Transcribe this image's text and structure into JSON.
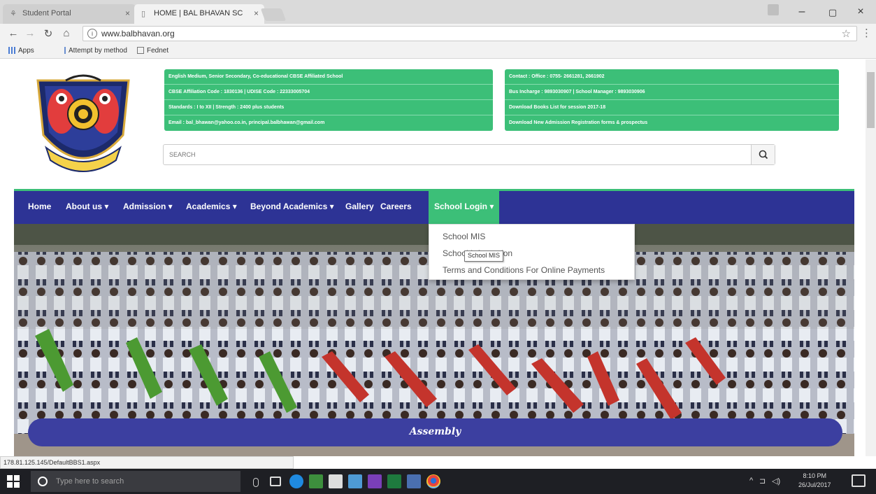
{
  "browser": {
    "tabs": [
      {
        "title": "Student Portal",
        "active": false
      },
      {
        "title": "HOME | BAL BHAVAN SC",
        "active": true
      }
    ],
    "url": "www.balbhavan.org",
    "bookmarks": [
      {
        "label": "Apps"
      },
      {
        "label": "Attempt by method"
      },
      {
        "label": "Fednet"
      }
    ],
    "window_controls": {
      "minimize": "–",
      "maximize": "▢",
      "close": "×"
    },
    "status_url": "178.81.125.145/DefaultBBS1.aspx"
  },
  "header": {
    "info_left": [
      "English Medium, Senior Secondary, Co-educational CBSE Affiliated School",
      "CBSE Affiliation Code : 1830136 | UDISE Code : 22333005704",
      "Standards : I to XII | Strength : 2400 plus students",
      "Email : bal_bhawan@yahoo.co.in, principal.balbhawan@gmail.com"
    ],
    "info_right": [
      "Contact : Office : 0755- 2661281, 2661902",
      "Bus Incharge : 9893030907 | School Manager : 9893030906",
      "Download Books List for session 2017-18",
      "Download New Admission Registration forms & prospectus"
    ],
    "search_placeholder": "SEARCH"
  },
  "nav": {
    "items": [
      {
        "label": "Home"
      },
      {
        "label": "About us ▾"
      },
      {
        "label": "Admission ▾"
      },
      {
        "label": "Academics ▾"
      },
      {
        "label": "Beyond Academics ▾"
      },
      {
        "label": "Gallery"
      },
      {
        "label": "Careers"
      },
      {
        "label": "School Login ▾",
        "active": true
      }
    ],
    "dropdown": [
      "School MIS",
      "School Information",
      "Terms and Conditions For Online Payments"
    ],
    "tooltip": "School MIS"
  },
  "hero": {
    "caption": "Assembly"
  },
  "taskbar": {
    "search_placeholder": "Type here to search",
    "time": "8:10 PM",
    "date": "26/Jul/2017"
  },
  "colors": {
    "nav_bg": "#2d3395",
    "accent_green": "#3cbf78",
    "caption_bg": "#3c3fa0"
  }
}
